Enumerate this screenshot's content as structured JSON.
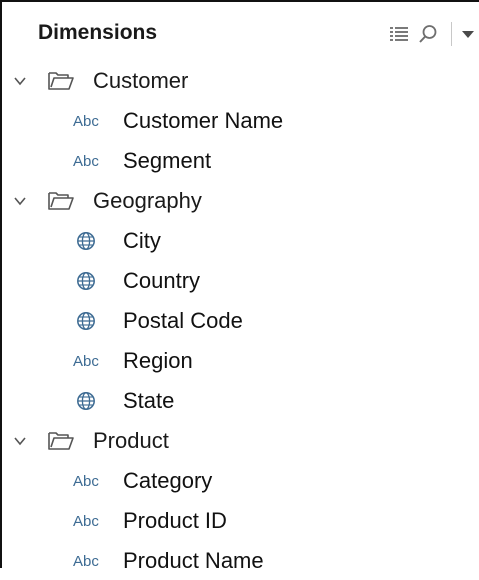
{
  "header": {
    "title": "Dimensions",
    "tools": [
      "list-view-icon",
      "search-icon",
      "dropdown-menu-icon"
    ]
  },
  "accent_colors": {
    "data_type_icon": "#3d6b93",
    "folder_icon": "#555555",
    "chevron": "#555555"
  },
  "folders": [
    {
      "label": "Customer",
      "expanded": true,
      "fields": [
        {
          "type": "string",
          "type_label": "Abc",
          "label": "Customer Name"
        },
        {
          "type": "string",
          "type_label": "Abc",
          "label": "Segment"
        }
      ]
    },
    {
      "label": "Geography",
      "expanded": true,
      "fields": [
        {
          "type": "geo",
          "type_label": "",
          "label": "City"
        },
        {
          "type": "geo",
          "type_label": "",
          "label": "Country"
        },
        {
          "type": "geo",
          "type_label": "",
          "label": "Postal Code"
        },
        {
          "type": "string",
          "type_label": "Abc",
          "label": "Region"
        },
        {
          "type": "geo",
          "type_label": "",
          "label": "State"
        }
      ]
    },
    {
      "label": "Product",
      "expanded": true,
      "fields": [
        {
          "type": "string",
          "type_label": "Abc",
          "label": "Category"
        },
        {
          "type": "string",
          "type_label": "Abc",
          "label": "Product ID"
        },
        {
          "type": "string",
          "type_label": "Abc",
          "label": "Product Name"
        }
      ]
    }
  ]
}
